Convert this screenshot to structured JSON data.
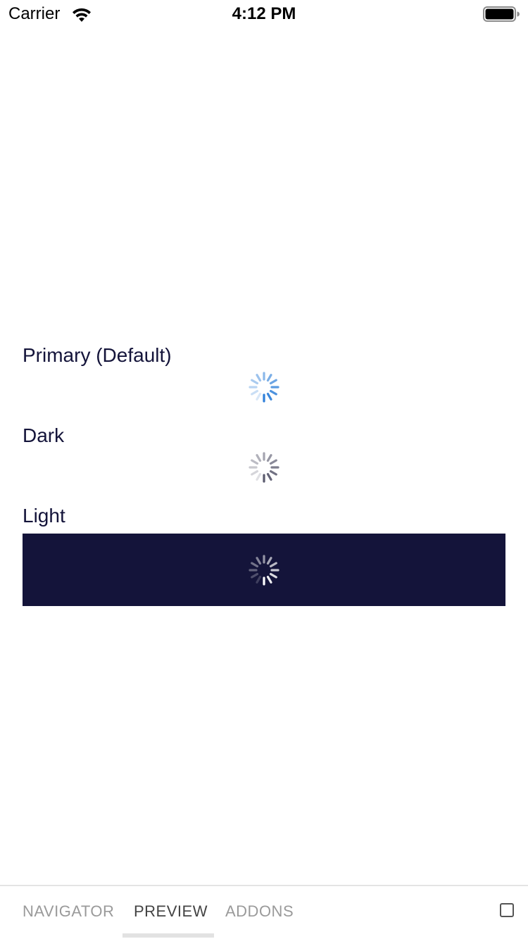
{
  "status_bar": {
    "carrier": "Carrier",
    "time": "4:12 PM",
    "wifi_icon": "wifi-icon",
    "battery_icon": "battery-icon",
    "battery_level": 1.0
  },
  "sections": {
    "primary": {
      "label": "Primary (Default)",
      "spinner_color": "#2e7fd9"
    },
    "dark": {
      "label": "Dark",
      "spinner_color": "#5a5a6e"
    },
    "light": {
      "label": "Light",
      "spinner_color": "#ffffff",
      "panel_color": "#14143a"
    }
  },
  "tab_bar": {
    "tabs": [
      {
        "label": "NAVIGATOR",
        "active": false
      },
      {
        "label": "PREVIEW",
        "active": true
      },
      {
        "label": "ADDONS",
        "active": false
      }
    ],
    "toggle_icon": "checkbox-icon"
  },
  "colors": {
    "text_primary": "#14143a",
    "tab_inactive": "#9a9a9a",
    "tab_active": "#444444"
  }
}
